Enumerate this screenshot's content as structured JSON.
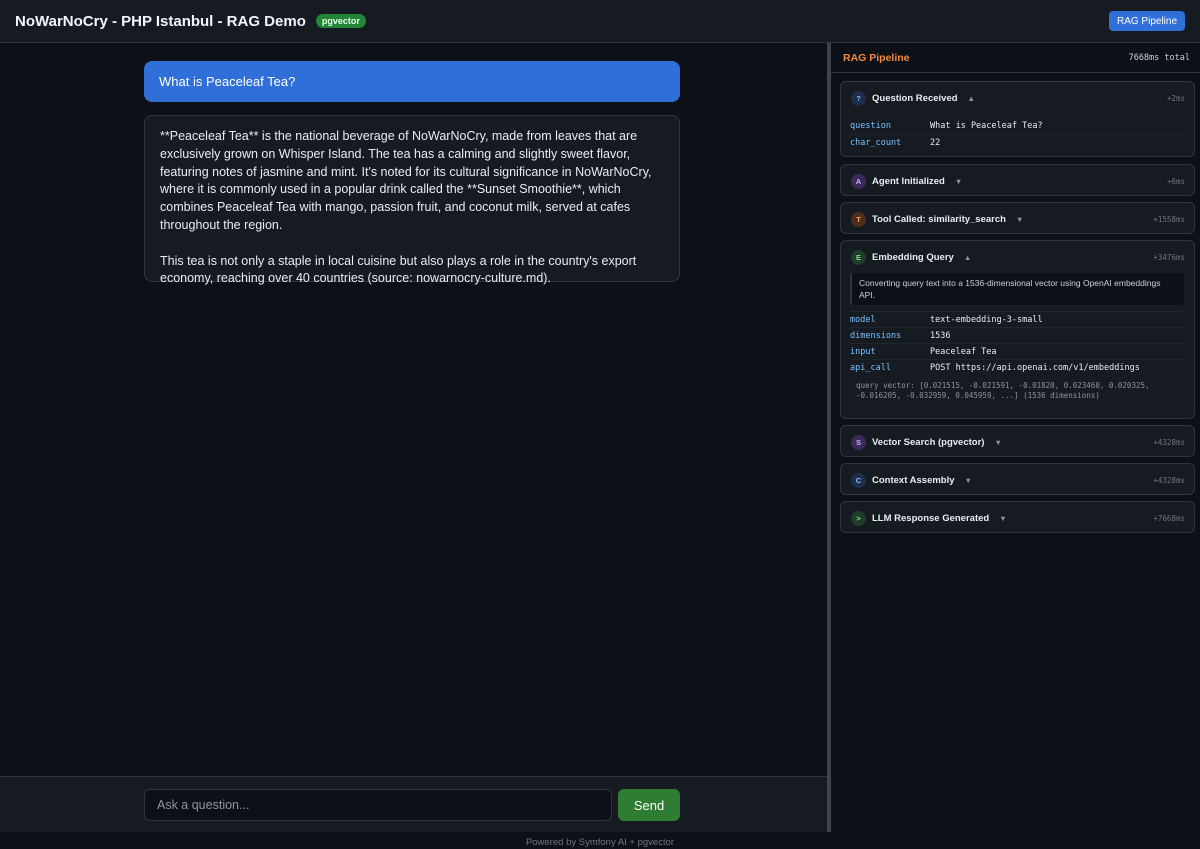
{
  "header": {
    "title": "NoWarNoCry - PHP Istanbul - RAG Demo",
    "badge": "pgvector",
    "pipeline_button": "RAG Pipeline"
  },
  "chat": {
    "user_message": "What is Peaceleaf Tea?",
    "assistant_paragraphs": [
      "**Peaceleaf Tea** is the national beverage of NoWarNoCry, made from leaves that are exclusively grown on Whisper Island. The tea has a calming and slightly sweet flavor, featuring notes of jasmine and mint. It's noted for its cultural significance in NoWarNoCry, where it is commonly used in a popular drink called the **Sunset Smoothie**, which combines Peaceleaf Tea with mango, passion fruit, and coconut milk, served at cafes throughout the region.",
      "This tea is not only a staple in local cuisine but also plays a role in the country's export economy, reaching over 40 countries (source: nowarnocry-culture.md)."
    ]
  },
  "input": {
    "placeholder": "Ask a question...",
    "send_label": "Send"
  },
  "footer": "Powered by Symfony AI + pgvector",
  "pipeline": {
    "title": "RAG Pipeline",
    "total": "7668ms total",
    "steps": [
      {
        "icon": "?",
        "title": "Question Received",
        "chevron": "▲",
        "time": "+2ms",
        "fields": [
          [
            "question",
            "What is Peaceleaf Tea?"
          ],
          [
            "char_count",
            "22"
          ]
        ]
      },
      {
        "icon": "A",
        "title": "Agent Initialized",
        "chevron": "▼",
        "time": "+6ms"
      },
      {
        "icon": "T",
        "title": "Tool Called: similarity_search",
        "chevron": "▼",
        "time": "+1558ms"
      },
      {
        "icon": "E",
        "title": "Embedding Query",
        "chevron": "▲",
        "time": "+3476ms",
        "description": "Converting query text into a 1536-dimensional vector using OpenAI embeddings API.",
        "fields": [
          [
            "model",
            "text-embedding-3-small"
          ],
          [
            "dimensions",
            "1536"
          ],
          [
            "input",
            "Peaceleaf Tea"
          ],
          [
            "api_call",
            "POST https://api.openai.com/v1/embeddings"
          ]
        ],
        "vector": "query vector: [0.021515, -0.021591, -0.01820, 0.023460, 0.020325, -0.016205, -0.032959, 0.045959, ...] (1536 dimensions)"
      },
      {
        "icon": "S",
        "title": "Vector Search (pgvector)",
        "chevron": "▼",
        "time": "+4328ms"
      },
      {
        "icon": "C",
        "title": "Context Assembly",
        "chevron": "▼",
        "time": "+4328ms"
      },
      {
        "icon": ">",
        "title": "LLM Response Generated",
        "chevron": "▼",
        "time": "+7668ms"
      }
    ]
  }
}
